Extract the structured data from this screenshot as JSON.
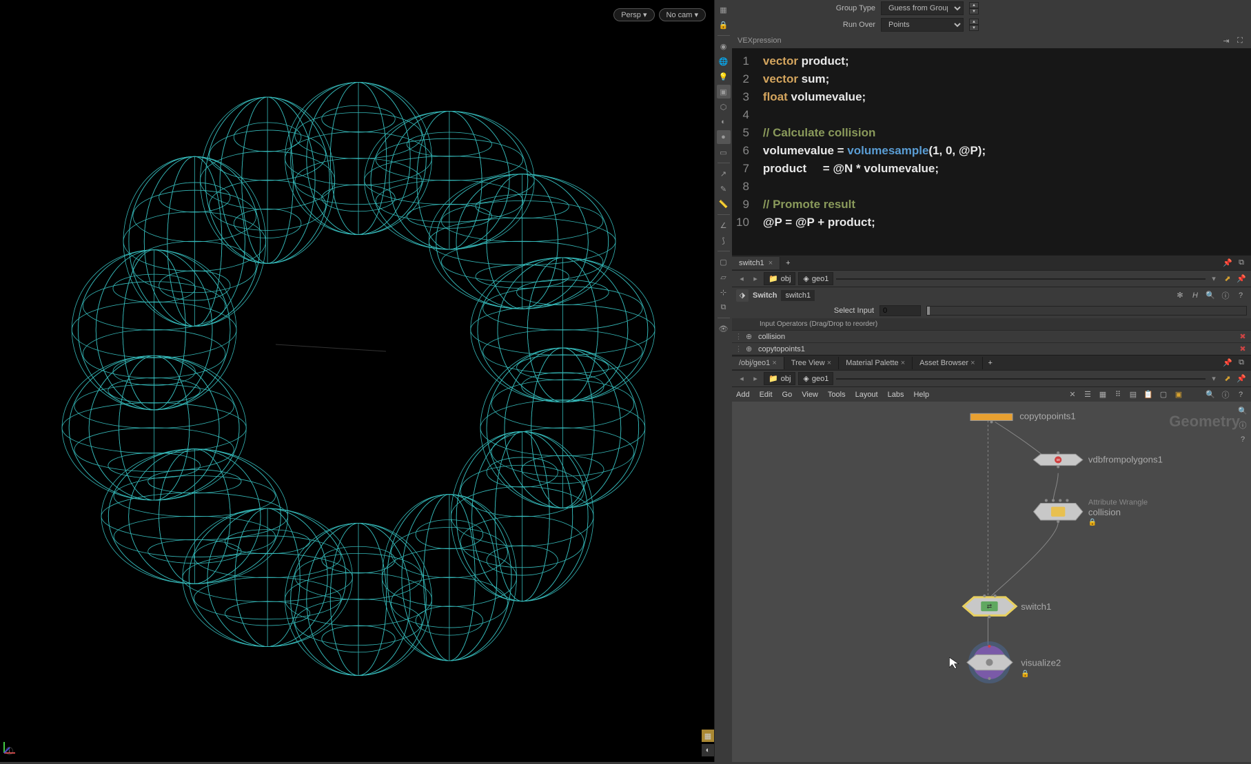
{
  "viewport": {
    "persp_label": "Persp",
    "camera_label": "No cam"
  },
  "params": {
    "group_type_label": "Group Type",
    "group_type_value": "Guess from Group",
    "run_over_label": "Run Over",
    "run_over_value": "Points",
    "vex_label": "VEXpression"
  },
  "code": {
    "lines": [
      {
        "n": 1,
        "segs": [
          {
            "c": "tok-type",
            "t": "vector "
          },
          {
            "c": "tok-var",
            "t": "product;"
          }
        ]
      },
      {
        "n": 2,
        "segs": [
          {
            "c": "tok-type",
            "t": "vector "
          },
          {
            "c": "tok-var",
            "t": "sum;"
          }
        ]
      },
      {
        "n": 3,
        "segs": [
          {
            "c": "tok-type",
            "t": "float "
          },
          {
            "c": "tok-var",
            "t": "volumevalue;"
          }
        ]
      },
      {
        "n": 4,
        "segs": []
      },
      {
        "n": 5,
        "segs": [
          {
            "c": "tok-comment",
            "t": "// Calculate collision"
          }
        ]
      },
      {
        "n": 6,
        "segs": [
          {
            "c": "tok-var",
            "t": "volumevalue = "
          },
          {
            "c": "tok-func",
            "t": "volumesample"
          },
          {
            "c": "tok-var",
            "t": "(1, 0, "
          },
          {
            "c": "tok-attr",
            "t": "@P"
          },
          {
            "c": "tok-var",
            "t": ");"
          }
        ]
      },
      {
        "n": 7,
        "segs": [
          {
            "c": "tok-var",
            "t": "product     = "
          },
          {
            "c": "tok-attr",
            "t": "@N"
          },
          {
            "c": "tok-var",
            "t": " * volumevalue;"
          }
        ]
      },
      {
        "n": 8,
        "segs": []
      },
      {
        "n": 9,
        "segs": [
          {
            "c": "tok-comment",
            "t": "// Promote result"
          }
        ]
      },
      {
        "n": 10,
        "segs": [
          {
            "c": "tok-attr",
            "t": "@P"
          },
          {
            "c": "tok-var",
            "t": " = "
          },
          {
            "c": "tok-attr",
            "t": "@P"
          },
          {
            "c": "tok-var",
            "t": " + product;"
          }
        ]
      }
    ]
  },
  "switch_tab": "switch1",
  "path": {
    "obj": "obj",
    "geo": "geo1"
  },
  "switch_node": {
    "type": "Switch",
    "name": "switch1",
    "select_input_label": "Select Input",
    "select_input_value": "0",
    "inputs_header": "Input Operators (Drag/Drop to reorder)",
    "inputs": [
      "collision",
      "copytopoints1"
    ]
  },
  "network_tabs": {
    "path": "/obj/geo1",
    "treeview": "Tree View",
    "material": "Material Palette",
    "asset": "Asset Browser"
  },
  "network_menu": [
    "Add",
    "Edit",
    "Go",
    "View",
    "Tools",
    "Layout",
    "Labs",
    "Help"
  ],
  "network": {
    "context": "Geometry",
    "nodes": {
      "copytopoints": "copytopoints1",
      "vdb": "vdbfrompolygons1",
      "wrangle_type": "Attribute Wrangle",
      "wrangle": "collision",
      "switch": "switch1",
      "visualize": "visualize2"
    }
  }
}
